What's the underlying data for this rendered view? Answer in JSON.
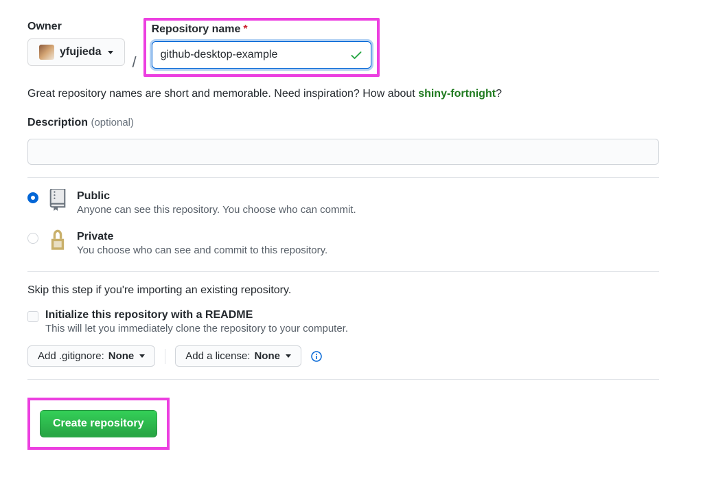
{
  "owner": {
    "label": "Owner",
    "username": "yfujieda"
  },
  "repoName": {
    "label": "Repository name",
    "value": "github-desktop-example"
  },
  "hint": {
    "prefix": "Great repository names are short and memorable. Need inspiration? How about ",
    "suggestion": "shiny-fortnight",
    "suffix": "?"
  },
  "description": {
    "label": "Description",
    "optional": "(optional)",
    "value": ""
  },
  "visibility": {
    "public": {
      "title": "Public",
      "desc": "Anyone can see this repository. You choose who can commit."
    },
    "private": {
      "title": "Private",
      "desc": "You choose who can see and commit to this repository."
    }
  },
  "skipText": "Skip this step if you're importing an existing repository.",
  "readme": {
    "title": "Initialize this repository with a README",
    "desc": "This will let you immediately clone the repository to your computer."
  },
  "dropdowns": {
    "gitignore": {
      "label": "Add .gitignore:",
      "value": "None"
    },
    "license": {
      "label": "Add a license:",
      "value": "None"
    }
  },
  "submit": "Create repository"
}
